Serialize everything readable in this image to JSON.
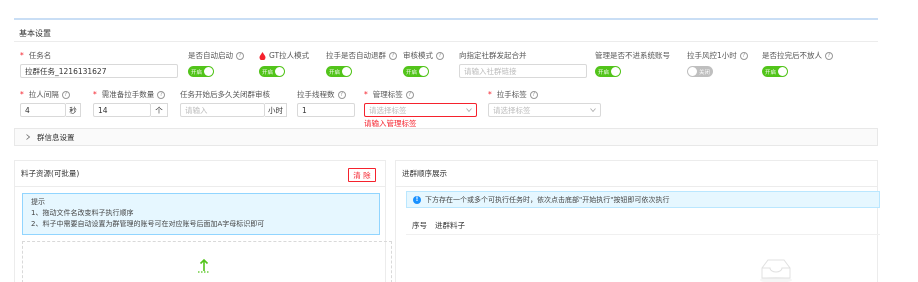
{
  "section": {
    "title": "基本设置"
  },
  "task_name": {
    "label": "任务名",
    "value": "拉群任务_1216131627"
  },
  "auto_start": {
    "label": "是否自动启动",
    "switch_text": "开启",
    "on": true
  },
  "gt_mode": {
    "label": "GT拉人模式",
    "switch_text": "开启",
    "on": true
  },
  "puller_auto_quit": {
    "label": "拉手是否自动退群",
    "switch_text": "开启",
    "on": true
  },
  "audit_mode": {
    "label": "审核模式",
    "switch_text": "开启",
    "on": true
  },
  "merge_community": {
    "label": "向指定社群发起合并",
    "placeholder": "请输入社群链接"
  },
  "manager_not_system": {
    "label": "管理是否不进系统账号",
    "switch_text": "开启",
    "on": true
  },
  "puller_risk": {
    "label": "拉手风控1小时",
    "switch_text": "关闭",
    "on": false
  },
  "no_after_full": {
    "label": "是否拉完后不放人",
    "switch_text": "开启",
    "on": true
  },
  "pull_interval": {
    "label": "拉人间隔",
    "value": "4",
    "unit": "秒"
  },
  "puller_count": {
    "label": "需准备拉手数量",
    "value": "14",
    "unit": "个"
  },
  "close_audit": {
    "label": "任务开始后多久关闭群审核",
    "placeholder": "请输入",
    "unit": "小时"
  },
  "puller_threads": {
    "label": "拉手线程数",
    "value": "1"
  },
  "manager_tag": {
    "label": "管理标签",
    "placeholder": "请选择标签",
    "error": "请输入管理标签"
  },
  "puller_tag": {
    "label": "拉手标签",
    "placeholder": "请选择标签"
  },
  "group_info": {
    "label": "群信息设置"
  },
  "materials": {
    "title": "料子资源(可批量)",
    "clear_label": "清 除",
    "tip_title": "提示",
    "tip_1": "1、拖动文件名改变料子执行顺序",
    "tip_2": "2、料子中需要自动设置为群管理的账号可在对应账号后面加A字母标识即可"
  },
  "order": {
    "title": "进群顺序展示",
    "info": "下方存在一个或多个可执行任务时，依次点击底部\"开始执行\"按钮即可依次执行",
    "col_index": "序号",
    "col_material": "进群料子"
  },
  "colors": {
    "accent": "#52c41a",
    "error": "#f5222d",
    "info": "#1890ff"
  }
}
